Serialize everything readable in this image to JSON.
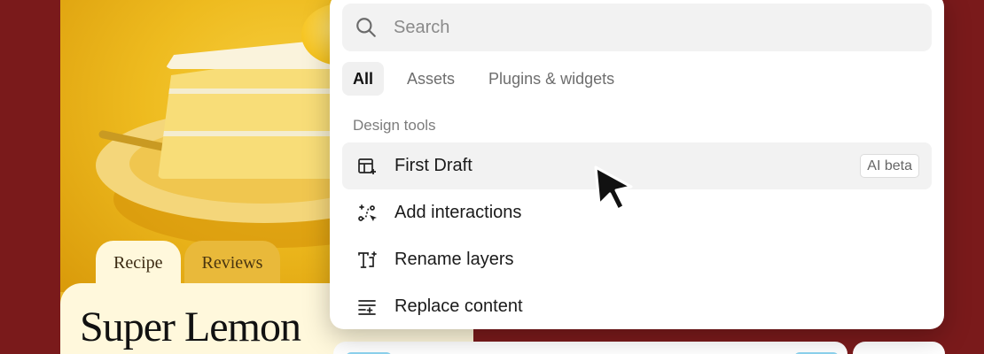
{
  "recipe": {
    "tabs": [
      {
        "label": "Recipe"
      },
      {
        "label": "Reviews"
      }
    ],
    "title": "Super Lemon"
  },
  "palette": {
    "search": {
      "placeholder": "Search",
      "value": ""
    },
    "filters": [
      {
        "label": "All",
        "active": true
      },
      {
        "label": "Assets",
        "active": false
      },
      {
        "label": "Plugins & widgets",
        "active": false
      }
    ],
    "section_label": "Design tools",
    "items": [
      {
        "label": "First Draft",
        "icon": "first-draft-icon",
        "badge": "AI beta",
        "highlighted": true
      },
      {
        "label": "Add interactions",
        "icon": "interactions-icon"
      },
      {
        "label": "Rename layers",
        "icon": "rename-layers-icon"
      },
      {
        "label": "Replace content",
        "icon": "replace-content-icon"
      }
    ]
  },
  "colors": {
    "background": "#7a1a1b",
    "card_yellow": "#e8b628",
    "sheet_cream": "#fff8dc",
    "highlight_row": "#f2f2f2"
  }
}
